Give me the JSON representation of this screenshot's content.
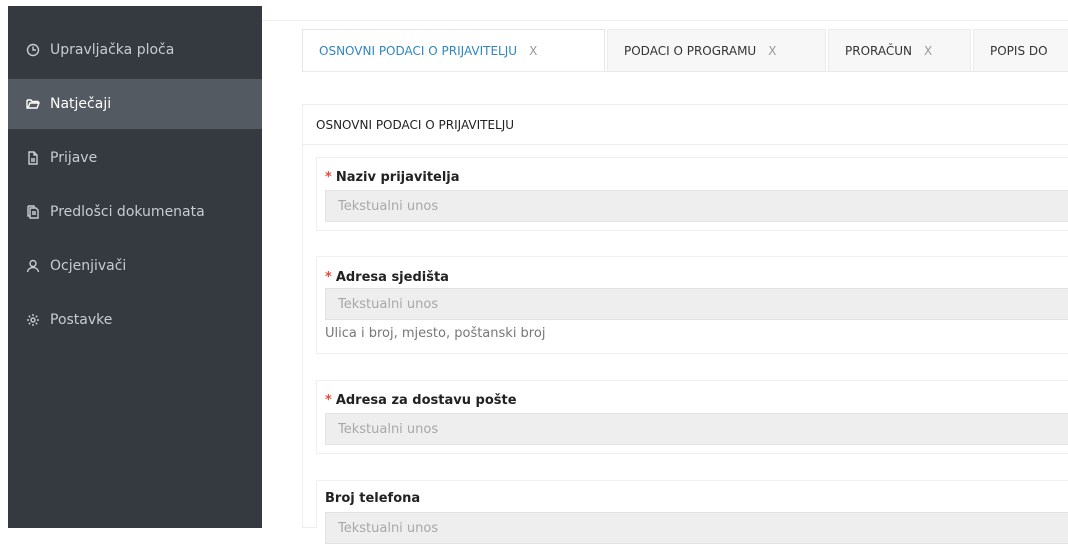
{
  "sidebar": {
    "items": [
      {
        "label": "Upravljačka ploča",
        "icon": "dashboard-clock-icon",
        "active": false
      },
      {
        "label": "Natječaji",
        "icon": "folder-open-icon",
        "active": true
      },
      {
        "label": "Prijave",
        "icon": "document-icon",
        "active": false
      },
      {
        "label": "Predlošci dokumenata",
        "icon": "copy-documents-icon",
        "active": false
      },
      {
        "label": "Ocjenjivači",
        "icon": "user-icon",
        "active": false
      },
      {
        "label": "Postavke",
        "icon": "gear-icon",
        "active": false
      }
    ]
  },
  "tabs": [
    {
      "label": "OSNOVNI PODACI O PRIJAVITELJU",
      "close": "X",
      "active": true
    },
    {
      "label": "PODACI O PROGRAMU",
      "close": "X",
      "active": false
    },
    {
      "label": "PRORAČUN",
      "close": "X",
      "active": false
    },
    {
      "label": "POPIS DO",
      "close": "",
      "active": false
    }
  ],
  "form": {
    "section_title": "OSNOVNI PODACI O PRIJAVITELJU",
    "fields": [
      {
        "label": "Naziv prijavitelja",
        "required": "*",
        "placeholder": "Tekstualni unos",
        "help": ""
      },
      {
        "label": "Adresa sjedišta",
        "required": "*",
        "placeholder": "Tekstualni unos",
        "help": "Ulica i broj, mjesto, poštanski broj"
      },
      {
        "label": "Adresa za dostavu pošte",
        "required": "*",
        "placeholder": "Tekstualni unos",
        "help": ""
      },
      {
        "label": "Broj telefona",
        "required": "",
        "placeholder": "Tekstualni unos",
        "help": ""
      }
    ]
  },
  "colors": {
    "sidebar_bg": "#343a40",
    "sidebar_active_bg": "#545a62",
    "active_tab_text": "#2e86c1",
    "required_marker": "#e74c3c"
  }
}
